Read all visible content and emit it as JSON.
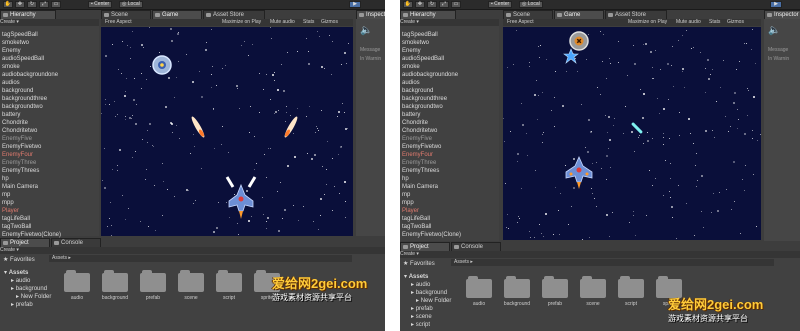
{
  "toolbar": {
    "center_label": "Center",
    "local_label": "Local"
  },
  "hierarchy": {
    "tab": "Hierarchy",
    "create": "Create",
    "items_left": [
      {
        "label": "tagSpeedBall",
        "style": ""
      },
      {
        "label": "smoketwo",
        "style": ""
      },
      {
        "label": "Enemy",
        "style": ""
      },
      {
        "label": "audioSpeedBall",
        "style": ""
      },
      {
        "label": "smoke",
        "style": ""
      },
      {
        "label": "audiobackgroundone",
        "style": ""
      },
      {
        "label": "audios",
        "style": ""
      },
      {
        "label": "background",
        "style": ""
      },
      {
        "label": "backgroundthree",
        "style": ""
      },
      {
        "label": "backgroundtwo",
        "style": ""
      },
      {
        "label": "battery",
        "style": ""
      },
      {
        "label": "Chondrite",
        "style": ""
      },
      {
        "label": "Chondritetwo",
        "style": ""
      },
      {
        "label": "EnemyFive",
        "style": "dim"
      },
      {
        "label": "EnemyFivetwo",
        "style": ""
      },
      {
        "label": "EnemyFour",
        "style": "red"
      },
      {
        "label": "EnemyThree",
        "style": "dim"
      },
      {
        "label": "EnemyThrees",
        "style": ""
      },
      {
        "label": "hp",
        "style": ""
      },
      {
        "label": "Main Camera",
        "style": ""
      },
      {
        "label": "mp",
        "style": ""
      },
      {
        "label": "mpp",
        "style": ""
      },
      {
        "label": "Player",
        "style": "red"
      },
      {
        "label": "tagLifeBall",
        "style": ""
      },
      {
        "label": "tagTwoBall",
        "style": ""
      },
      {
        "label": "EnemyFivetwo(Clone)",
        "style": ""
      }
    ],
    "items_right": [
      {
        "label": "tagSpeedBall",
        "style": ""
      },
      {
        "label": "smoketwo",
        "style": ""
      },
      {
        "label": "Enemy",
        "style": ""
      },
      {
        "label": "audioSpeedBall",
        "style": ""
      },
      {
        "label": "smoke",
        "style": ""
      },
      {
        "label": "audiobackgroundone",
        "style": ""
      },
      {
        "label": "audios",
        "style": ""
      },
      {
        "label": "background",
        "style": ""
      },
      {
        "label": "backgroundthree",
        "style": ""
      },
      {
        "label": "backgroundtwo",
        "style": ""
      },
      {
        "label": "battery",
        "style": ""
      },
      {
        "label": "Chondrite",
        "style": ""
      },
      {
        "label": "Chondritetwo",
        "style": ""
      },
      {
        "label": "EnemyFive",
        "style": "dim"
      },
      {
        "label": "EnemyFivetwo",
        "style": ""
      },
      {
        "label": "EnemyFour",
        "style": "red"
      },
      {
        "label": "EnemyThree",
        "style": "dim"
      },
      {
        "label": "EnemyThrees",
        "style": ""
      },
      {
        "label": "hp",
        "style": ""
      },
      {
        "label": "Main Camera",
        "style": ""
      },
      {
        "label": "mp",
        "style": ""
      },
      {
        "label": "mpp",
        "style": ""
      },
      {
        "label": "Player",
        "style": "red"
      },
      {
        "label": "tagLifeBall",
        "style": ""
      },
      {
        "label": "tagTwoBall",
        "style": ""
      },
      {
        "label": "EnemyFivetwo(Clone)",
        "style": ""
      }
    ]
  },
  "tabs": {
    "scene": "Scene",
    "game": "Game",
    "asset_store": "Asset Store",
    "inspector": "Inspector",
    "project": "Project",
    "console": "Console"
  },
  "game_bar": {
    "aspect": "Free Aspect",
    "maximize": "Maximize on Play",
    "mute": "Mute audio",
    "stats": "Stats",
    "gizmos": "Gizmos"
  },
  "inspector": {
    "message": "Message",
    "in_warning": "In Warnin"
  },
  "project": {
    "create": "Create",
    "favorites": "Favorites",
    "assets_header": "Assets",
    "tree_left": [
      "Assets",
      "audio",
      "background",
      "New Folder",
      "prefab"
    ],
    "tree_right": [
      "Assets",
      "audio",
      "background",
      "New Folder",
      "prefab",
      "scene",
      "script"
    ],
    "folders_left": [
      "audio",
      "background",
      "prefab",
      "scene",
      "script",
      "sprite"
    ],
    "folders_right": [
      "audio",
      "background",
      "prefab",
      "scene",
      "script",
      "sprite"
    ]
  },
  "watermark": {
    "site": "爱给网2gei.com",
    "tagline": "游戏素材资源共享平台"
  },
  "colors": {
    "space": "#0a0f3a",
    "panel": "#414141",
    "prefab_text": "#8fb0e6",
    "error_text": "#e07a6e",
    "watermark": "#ffcc3a"
  }
}
